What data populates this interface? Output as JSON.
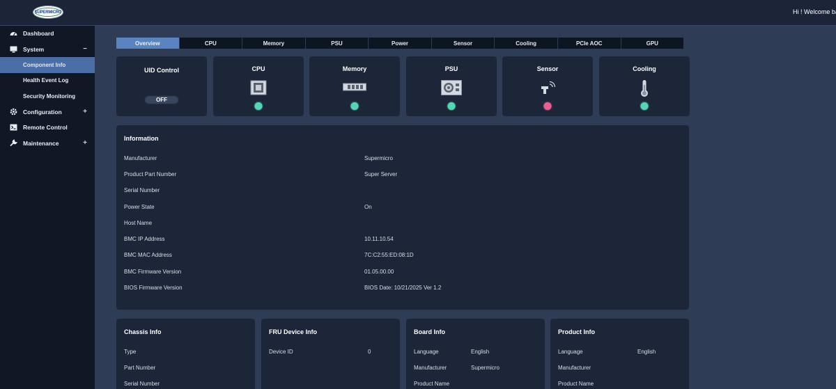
{
  "header": {
    "logo_text": "SUPERMICRO",
    "welcome": "Hi ! Welcome back"
  },
  "sidebar": {
    "items": [
      {
        "label": "Dashboard",
        "icon": "dashboard-icon"
      },
      {
        "label": "System",
        "icon": "monitor-icon",
        "toggle": "−"
      },
      {
        "label": "Component Info",
        "sub": true,
        "active": true
      },
      {
        "label": "Health Event Log",
        "sub": true
      },
      {
        "label": "Security Monitoring",
        "sub": true
      },
      {
        "label": "Configuration",
        "icon": "gear-icon",
        "toggle": "+"
      },
      {
        "label": "Remote Control",
        "icon": "terminal-icon"
      },
      {
        "label": "Maintenance",
        "icon": "wrench-icon",
        "toggle": "+"
      }
    ]
  },
  "tabs": [
    "Overview",
    "CPU",
    "Memory",
    "PSU",
    "Power",
    "Sensor",
    "Cooling",
    "PCIe AOC",
    "GPU"
  ],
  "cards": {
    "uid": {
      "title": "UID Control",
      "state": "OFF"
    },
    "cpu": {
      "title": "CPU",
      "status": "ok"
    },
    "memory": {
      "title": "Memory",
      "status": "ok"
    },
    "psu": {
      "title": "PSU",
      "status": "ok"
    },
    "sensor": {
      "title": "Sensor",
      "status": "critical"
    },
    "cooling": {
      "title": "Cooling",
      "status": "ok"
    }
  },
  "status_colors": {
    "ok": "#52d6b3",
    "critical": "#e8608e"
  },
  "information": {
    "title": "Information",
    "rows": [
      {
        "label": "Manufacturer",
        "value": "Supermicro"
      },
      {
        "label": "Product Part Number",
        "value": "Super Server"
      },
      {
        "label": "Serial Number",
        "value": ""
      },
      {
        "label": "Power State",
        "value": "On"
      },
      {
        "label": "Host Name",
        "value": ""
      },
      {
        "label": "BMC IP Address",
        "value": "10.11.10.54"
      },
      {
        "label": "BMC MAC Address",
        "value": "7C:C2:55:ED:08:1D"
      },
      {
        "label": "BMC Firmware Version",
        "value": "01.05.00.00"
      },
      {
        "label": "BIOS Firmware Version",
        "value": "BIOS Date: 10/21/2025 Ver 1.2"
      }
    ]
  },
  "chassis": {
    "title": "Chassis Info",
    "rows": [
      {
        "label": "Type",
        "value": ""
      },
      {
        "label": "Part Number",
        "value": ""
      },
      {
        "label": "Serial Number",
        "value": ""
      }
    ]
  },
  "fru": {
    "title": "FRU Device Info",
    "rows": [
      {
        "label": "Device ID",
        "value": "0"
      }
    ]
  },
  "board": {
    "title": "Board Info",
    "rows": [
      {
        "label": "Language",
        "value": "English"
      },
      {
        "label": "Manufacturer",
        "value": "Supermicro"
      },
      {
        "label": "Product Name",
        "value": ""
      }
    ]
  },
  "product": {
    "title": "Product Info",
    "rows": [
      {
        "label": "Language",
        "value": "English"
      },
      {
        "label": "Manufacturer",
        "value": ""
      },
      {
        "label": "Product Name",
        "value": ""
      }
    ]
  }
}
